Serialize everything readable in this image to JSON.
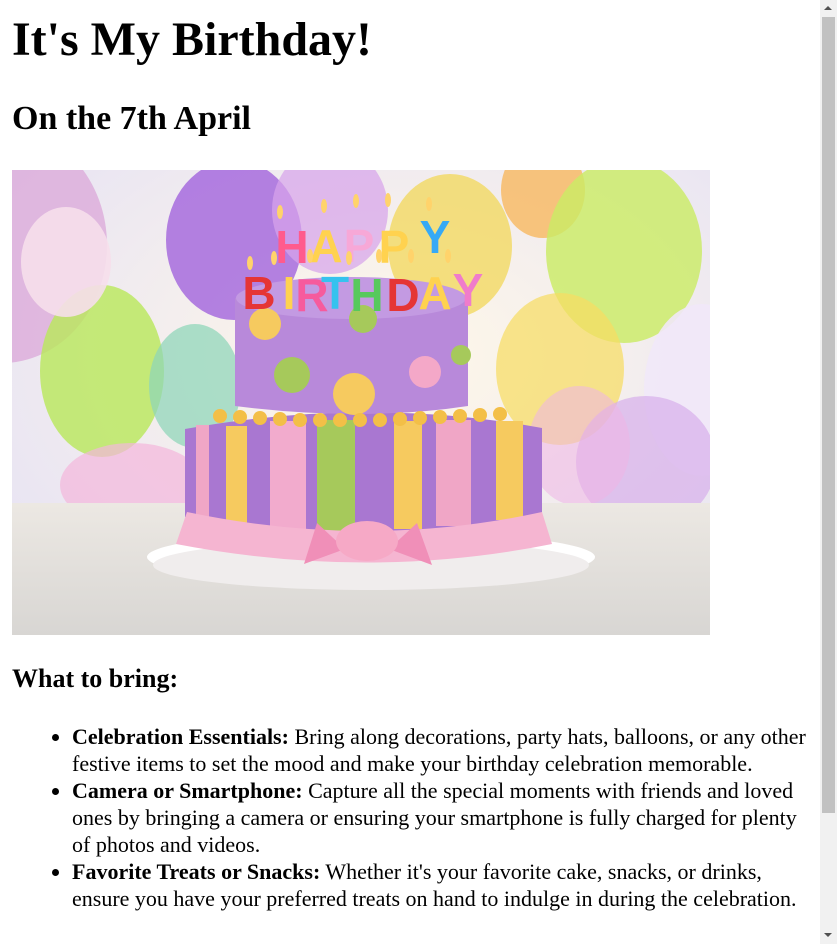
{
  "page": {
    "title": "It's My Birthday!",
    "subtitle": "On the 7th April"
  },
  "hero_image": {
    "icon": "birthday-cake-image",
    "cake_topper": "HAPPY BIRTHDAY"
  },
  "bring": {
    "heading": "What to bring:",
    "items": [
      {
        "title": "Celebration Essentials:",
        "text": " Bring along decorations, party hats, balloons, or any other festive items to set the mood and make your birthday celebration memorable."
      },
      {
        "title": "Camera or Smartphone:",
        "text": " Capture all the special moments with friends and loved ones by bringing a camera or ensuring your smartphone is fully charged for plenty of photos and videos."
      },
      {
        "title": "Favorite Treats or Snacks:",
        "text": " Whether it's your favorite cake, snacks, or drinks, ensure you have your preferred treats on hand to indulge in during the celebration."
      }
    ]
  },
  "scrollbar": {
    "up_icon": "chevron-up-icon",
    "down_icon": "chevron-down-icon"
  },
  "colors": {
    "text": "#000000",
    "background": "#ffffff",
    "scroll_track": "#f1f1f1",
    "scroll_thumb": "#c1c1c1"
  }
}
